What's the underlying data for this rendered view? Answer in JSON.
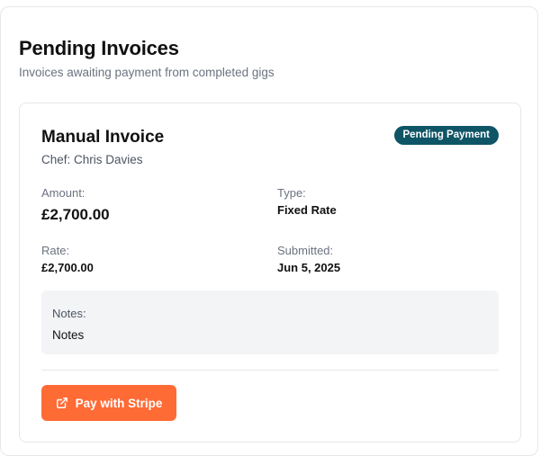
{
  "header": {
    "title": "Pending Invoices",
    "subtitle": "Invoices awaiting payment from completed gigs"
  },
  "invoice": {
    "title": "Manual Invoice",
    "chef": "Chef: Chris Davies",
    "status": "Pending Payment",
    "amount_label": "Amount:",
    "amount_value": "£2,700.00",
    "type_label": "Type:",
    "type_value": "Fixed Rate",
    "rate_label": "Rate:",
    "rate_value": "£2,700.00",
    "submitted_label": "Submitted:",
    "submitted_value": "Jun 5, 2025",
    "notes_label": "Notes:",
    "notes_value": "Notes",
    "pay_button_label": "Pay with Stripe",
    "pay_button_icon": "external-link-icon"
  },
  "colors": {
    "badge_bg": "#0e5566",
    "button_bg": "#ff6b35",
    "notes_bg": "#f3f4f6"
  }
}
